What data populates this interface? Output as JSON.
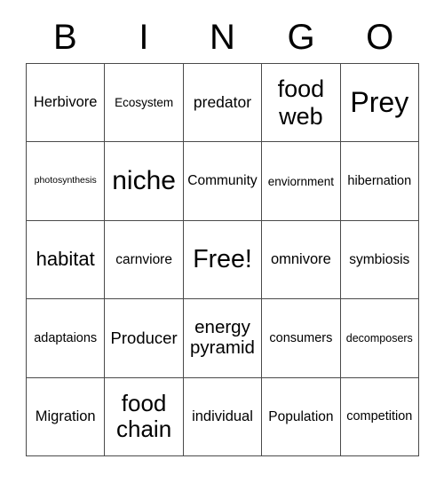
{
  "card": {
    "header_letters": [
      "B",
      "I",
      "N",
      "G",
      "O"
    ],
    "grid_size": "5x5",
    "line_color": "#4a4a4a",
    "background_color": "#ffffff",
    "text_color": "#000000",
    "rows": [
      [
        {
          "text": "Herbivore",
          "size": "fs-16"
        },
        {
          "text": "Ecosystem",
          "size": "fs-13"
        },
        {
          "text": "predator",
          "size": "fs-17"
        },
        {
          "text": "food web",
          "size": "fs-27"
        },
        {
          "text": "Prey",
          "size": "fs-32"
        }
      ],
      [
        {
          "text": "photosynthesis",
          "size": "fs-10"
        },
        {
          "text": "niche",
          "size": "fs-30"
        },
        {
          "text": "Community",
          "size": "fs-15"
        },
        {
          "text": "enviornment",
          "size": "fs-13"
        },
        {
          "text": "hibernation",
          "size": "fs-14"
        }
      ],
      [
        {
          "text": "habitat",
          "size": "fs-22"
        },
        {
          "text": "carnviore",
          "size": "fs-15"
        },
        {
          "text": "Free!",
          "size": "fs-28"
        },
        {
          "text": "omnivore",
          "size": "fs-16"
        },
        {
          "text": "symbiosis",
          "size": "fs-15"
        }
      ],
      [
        {
          "text": "adaptaions",
          "size": "fs-14"
        },
        {
          "text": "Producer",
          "size": "fs-18"
        },
        {
          "text": "energy pyramid",
          "size": "fs-20"
        },
        {
          "text": "consumers",
          "size": "fs-14"
        },
        {
          "text": "decomposers",
          "size": "fs-12"
        }
      ],
      [
        {
          "text": "Migration",
          "size": "fs-16"
        },
        {
          "text": "food chain",
          "size": "fs-26"
        },
        {
          "text": "individual",
          "size": "fs-16"
        },
        {
          "text": "Population",
          "size": "fs-15"
        },
        {
          "text": "competition",
          "size": "fs-14"
        }
      ]
    ]
  }
}
